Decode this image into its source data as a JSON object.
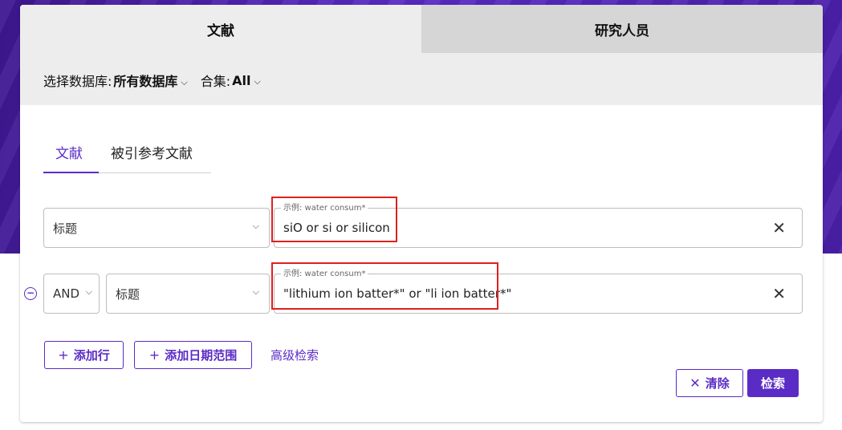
{
  "top_tabs": [
    {
      "label": "文献",
      "active": true
    },
    {
      "label": "研究人员",
      "active": false
    }
  ],
  "database_bar": {
    "db_label": "选择数据库:",
    "db_value": "所有数据库",
    "collection_label": "合集:",
    "collection_value": "All"
  },
  "sub_tabs": [
    {
      "label": "文献",
      "active": true
    },
    {
      "label": "被引参考文献",
      "active": false
    }
  ],
  "rows": [
    {
      "field_select": "标题",
      "input_legend": "示例: water consum*",
      "input_value": "siO or si or silicon"
    },
    {
      "operator": "AND",
      "field_select": "标题",
      "input_legend": "示例: water consum*",
      "input_value": "\"lithium ion batter*\" or \"li ion batter*\""
    }
  ],
  "actions": {
    "add_row": "添加行",
    "add_date_range": "添加日期范围",
    "advanced_search": "高级检索",
    "clear": "清除",
    "search": "检索"
  },
  "colors": {
    "accent": "#5b2bc6",
    "highlight_box": "#e02020",
    "panel_gray": "#ededed"
  }
}
